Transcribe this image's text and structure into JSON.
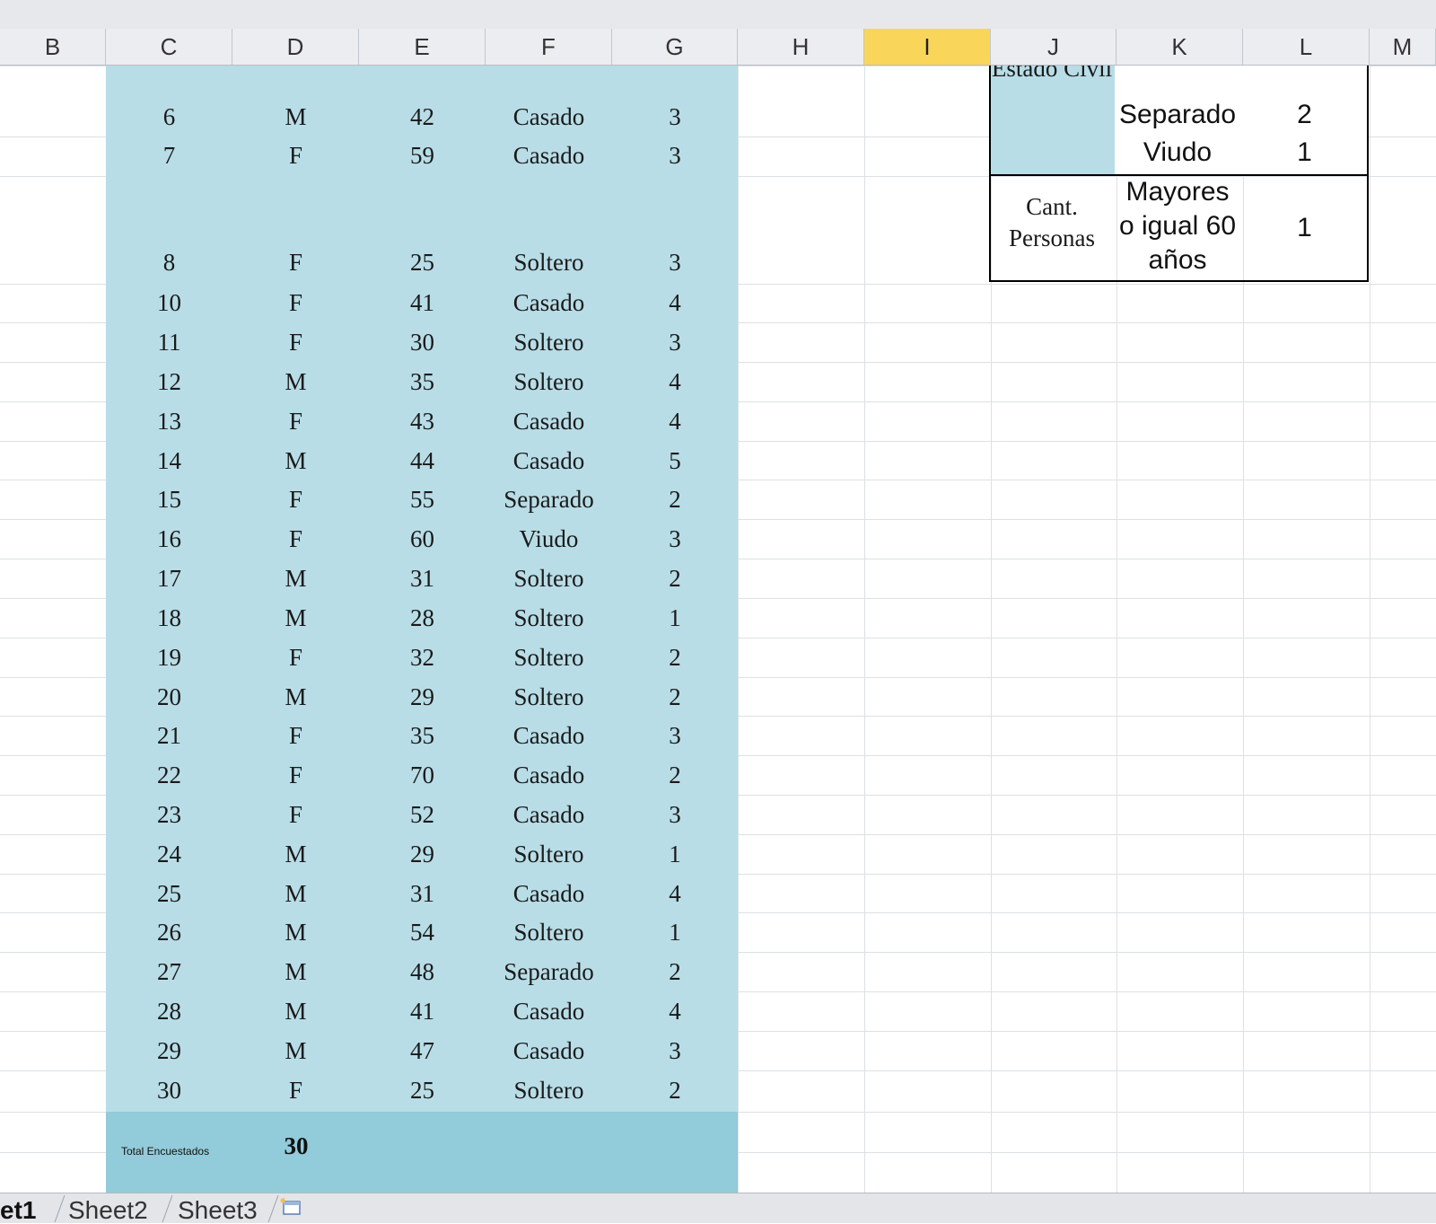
{
  "columns": [
    "B",
    "C",
    "D",
    "E",
    "F",
    "G",
    "H",
    "I",
    "J",
    "K",
    "L",
    "M"
  ],
  "selected_column": "I",
  "rows": [
    {
      "c": "6",
      "d": "M",
      "e": "42",
      "f": "Casado",
      "g": "3"
    },
    {
      "c": "7",
      "d": "F",
      "e": "59",
      "f": "Casado",
      "g": "3"
    },
    {
      "c": "8",
      "d": "F",
      "e": "25",
      "f": "Soltero",
      "g": "3"
    },
    {
      "c": "10",
      "d": "F",
      "e": "41",
      "f": "Casado",
      "g": "4"
    },
    {
      "c": "11",
      "d": "F",
      "e": "30",
      "f": "Soltero",
      "g": "3"
    },
    {
      "c": "12",
      "d": "M",
      "e": "35",
      "f": "Soltero",
      "g": "4"
    },
    {
      "c": "13",
      "d": "F",
      "e": "43",
      "f": "Casado",
      "g": "4"
    },
    {
      "c": "14",
      "d": "M",
      "e": "44",
      "f": "Casado",
      "g": "5"
    },
    {
      "c": "15",
      "d": "F",
      "e": "55",
      "f": "Separado",
      "g": "2"
    },
    {
      "c": "16",
      "d": "F",
      "e": "60",
      "f": "Viudo",
      "g": "3"
    },
    {
      "c": "17",
      "d": "M",
      "e": "31",
      "f": "Soltero",
      "g": "2"
    },
    {
      "c": "18",
      "d": "M",
      "e": "28",
      "f": "Soltero",
      "g": "1"
    },
    {
      "c": "19",
      "d": "F",
      "e": "32",
      "f": "Soltero",
      "g": "2"
    },
    {
      "c": "20",
      "d": "M",
      "e": "29",
      "f": "Soltero",
      "g": "2"
    },
    {
      "c": "21",
      "d": "F",
      "e": "35",
      "f": "Casado",
      "g": "3"
    },
    {
      "c": "22",
      "d": "F",
      "e": "70",
      "f": "Casado",
      "g": "2"
    },
    {
      "c": "23",
      "d": "F",
      "e": "52",
      "f": "Casado",
      "g": "3"
    },
    {
      "c": "24",
      "d": "M",
      "e": "29",
      "f": "Soltero",
      "g": "1"
    },
    {
      "c": "25",
      "d": "M",
      "e": "31",
      "f": "Casado",
      "g": "4"
    },
    {
      "c": "26",
      "d": "M",
      "e": "54",
      "f": "Soltero",
      "g": "1"
    },
    {
      "c": "27",
      "d": "M",
      "e": "48",
      "f": "Separado",
      "g": "2"
    },
    {
      "c": "28",
      "d": "M",
      "e": "41",
      "f": "Casado",
      "g": "4"
    },
    {
      "c": "29",
      "d": "M",
      "e": "47",
      "f": "Casado",
      "g": "3"
    },
    {
      "c": "30",
      "d": "F",
      "e": "25",
      "f": "Soltero",
      "g": "2"
    }
  ],
  "total": {
    "label": "Total Encuestados",
    "value": "30"
  },
  "summary": {
    "estado_civil_label": "Estado Civil",
    "separado_label": "Separado",
    "separado_value": "2",
    "viudo_label": "Viudo",
    "viudo_value": "1",
    "cant_personas_label": "Cant. Personas",
    "mayores_label": "Mayores o igual 60 años",
    "mayores_value": "1"
  },
  "sheet_tabs": [
    "et1",
    "Sheet2",
    "Sheet3"
  ],
  "active_tab": "et1"
}
